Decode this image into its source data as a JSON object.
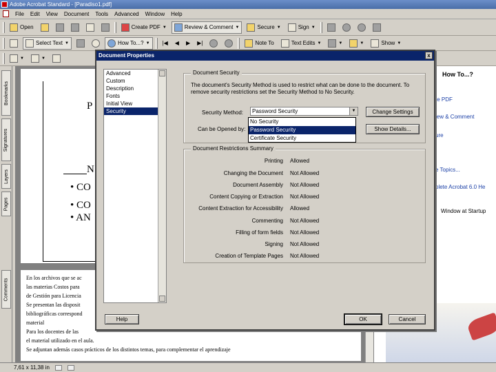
{
  "window": {
    "title": "Adobe Acrobat Standard - [Paradiso1.pdf]"
  },
  "menu": [
    "File",
    "Edit",
    "View",
    "Document",
    "Tools",
    "Advanced",
    "Window",
    "Help"
  ],
  "toolbar1": {
    "open": "Open",
    "create_pdf": "Create PDF",
    "review_comment": "Review & Comment",
    "secure": "Secure",
    "sign": "Sign"
  },
  "toolbar2": {
    "select_text": "Select Text",
    "how_to": "How To...?",
    "note_tool": "Note To",
    "text_edits": "Text Edits",
    "show": "Show"
  },
  "nav_tabs": [
    "Bookmarks",
    "Signatures",
    "Layers",
    "Pages",
    "Comments"
  ],
  "document": {
    "page1_letters": [
      "P",
      "N"
    ],
    "bullets": [
      "• CO",
      "• CO",
      "• AN"
    ],
    "paragraphs": [
      "En los archivos que se ac",
      "las materias Costos para",
      "de Gestión para Licencia",
      "Se presentan las disposit",
      "bibliográficas correspond",
      "material",
      "Para los docentes de las",
      "el material utilizado en el aula.",
      "Se adjuntan además casos prácticos de los distintos temas, para complementar el aprendizaje"
    ]
  },
  "status": {
    "page_size": "7,61 x 11,38 in"
  },
  "howto": {
    "title": "How To...?",
    "links": [
      "te PDF",
      "iew & Comment",
      "ure",
      "e Topics...",
      "plete Acrobat 6.0 He",
      "Window at Startup"
    ]
  },
  "dialog": {
    "title": "Document Properties",
    "close": "x",
    "categories": [
      "Advanced",
      "Custom",
      "Description",
      "Fonts",
      "Initial View",
      "Security"
    ],
    "selected_category": "Security",
    "security": {
      "legend": "Document Security",
      "description": "The document's Security Method is used to restrict what can be done to the document. To remove security restrictions set the Security Method to No Security.",
      "method_label": "Security Method:",
      "method_value": "Password Security",
      "opened_label": "Can be Opened by:",
      "change_settings": "Change Settings",
      "show_details": "Show Details...",
      "options": [
        "No Security",
        "Password Security",
        "Certificate Security"
      ],
      "selected_option": "Password Security"
    },
    "restrictions": {
      "legend": "Document Restrictions Summary",
      "rows": [
        {
          "label": "Printing",
          "value": "Allowed"
        },
        {
          "label": "Changing the Document",
          "value": "Not Allowed"
        },
        {
          "label": "Document Assembly",
          "value": "Not Allowed"
        },
        {
          "label": "Content Copying or Extraction",
          "value": "Not Allowed"
        },
        {
          "label": "Content Extraction for Accessibility",
          "value": "Allowed"
        },
        {
          "label": "Commenting",
          "value": "Not Allowed"
        },
        {
          "label": "Filling of form fields",
          "value": "Not Allowed"
        },
        {
          "label": "Signing",
          "value": "Not Allowed"
        },
        {
          "label": "Creation of Template Pages",
          "value": "Not Allowed"
        }
      ]
    },
    "help": "Help",
    "ok": "OK",
    "cancel": "Cancel"
  }
}
